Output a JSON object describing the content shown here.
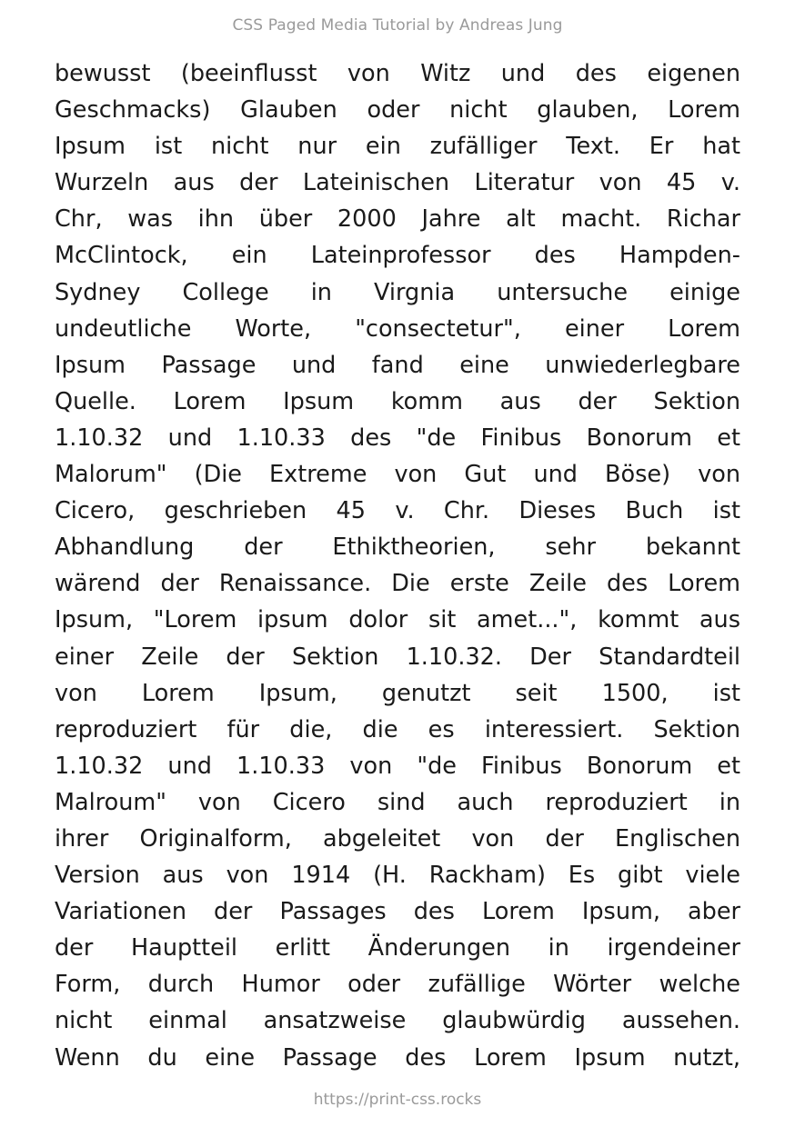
{
  "header": {
    "running_title": "CSS Paged Media Tutorial by Andreas Jung"
  },
  "body": {
    "lines": [
      "bewusst (beeinflusst von Witz und des eigenen",
      "Geschmacks) Glauben oder nicht glauben, Lorem",
      "Ipsum ist nicht nur ein zufälliger Text. Er hat",
      "Wurzeln aus der Lateinischen Literatur von 45 v.",
      "Chr, was ihn über 2000 Jahre alt macht. Richar",
      "McClintock, ein Lateinprofessor des Hampden-",
      "Sydney College in Virgnia untersuche einige",
      "undeutliche Worte, \"consectetur\", einer Lorem",
      "Ipsum Passage und fand eine unwiederlegbare",
      "Quelle. Lorem Ipsum komm aus der Sektion",
      "1.10.32 und 1.10.33 des \"de Finibus Bonorum et",
      "Malorum\" (Die Extreme von Gut und Böse) von",
      "Cicero, geschrieben 45 v. Chr. Dieses Buch ist",
      "Abhandlung der Ethiktheorien, sehr bekannt",
      "wärend der Renaissance. Die erste Zeile des Lorem",
      "Ipsum, \"Lorem ipsum dolor sit amet...\", kommt aus",
      "einer Zeile der Sektion 1.10.32. Der Standardteil",
      "von Lorem Ipsum, genutzt seit 1500, ist",
      "reproduziert für die, die es interessiert. Sektion",
      "1.10.32 und 1.10.33 von \"de Finibus Bonorum et",
      "Malroum\" von Cicero sind auch reproduziert in",
      "ihrer Originalform, abgeleitet von der Englischen",
      "Version aus von 1914 (H. Rackham) Es gibt viele",
      "Variationen der Passages des Lorem Ipsum, aber",
      "der Hauptteil erlitt Änderungen in irgendeiner",
      "Form, durch Humor oder zufällige Wörter welche",
      "nicht einmal ansatzweise glaubwürdig aussehen.",
      "Wenn du eine Passage des Lorem Ipsum nutzt,"
    ]
  },
  "footer": {
    "url": "https://print-css.rocks"
  }
}
